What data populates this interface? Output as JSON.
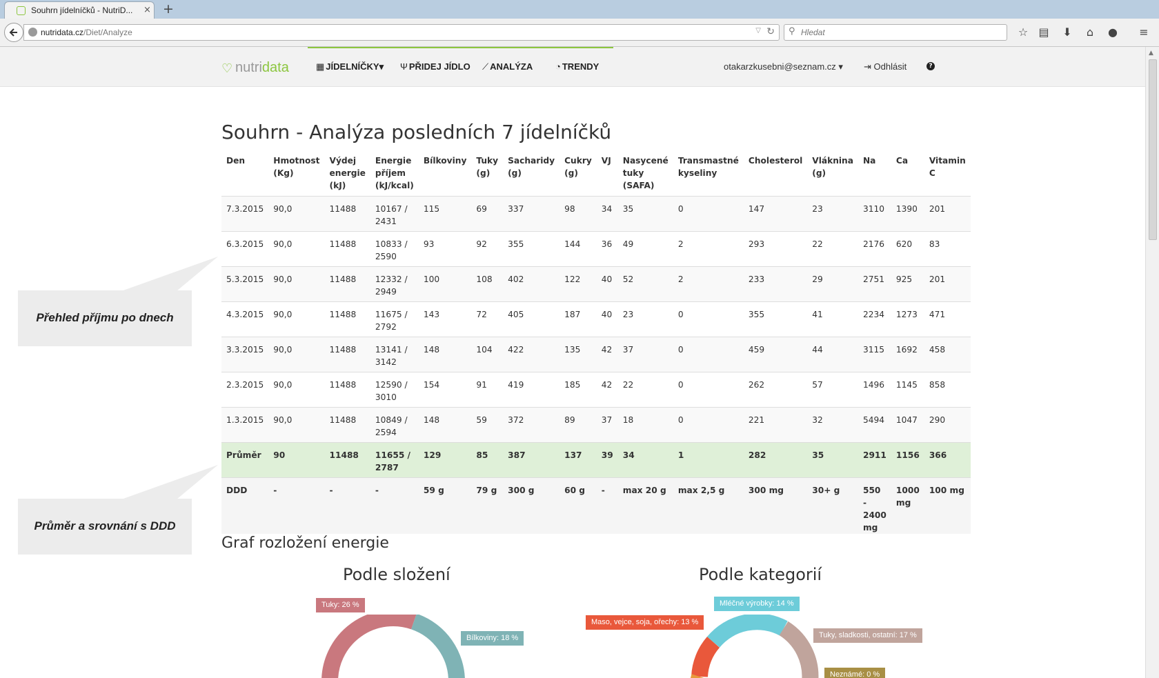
{
  "browser": {
    "tab_title": "Souhrn jídelníčků - NutriD...",
    "tab_close": "×",
    "new_tab": "+",
    "url_host": "nutridata.cz",
    "url_path": "/Diet/Analyze",
    "search_placeholder": "Hledat"
  },
  "site": {
    "logo_text_a": "nutri",
    "logo_text_b": "data",
    "nav": [
      {
        "label": "JÍDELNÍČKY",
        "icon": "calendar-icon",
        "has_dropdown": true
      },
      {
        "label": "PŘIDEJ JÍDLO",
        "icon": "cutlery-icon"
      },
      {
        "label": "ANALÝZA",
        "icon": "line-chart-icon"
      },
      {
        "label": "TRENDY",
        "icon": "dashboard-icon"
      }
    ],
    "user_email": "otakarzkusebni@seznam.cz",
    "logout_label": "Odhlásit",
    "help_label": "?"
  },
  "page_title": "Souhrn - Analýza posledních 7 jídelníčků",
  "table": {
    "headers": [
      "Den",
      "Hmotnost (Kg)",
      "Výdej energie (kJ)",
      "Energie příjem (kJ/kcal)",
      "Bílkoviny",
      "Tuky (g)",
      "Sacharidy (g)",
      "Cukry (g)",
      "VJ",
      "Nasycené tuky (SAFA)",
      "Transmastné kyseliny",
      "Cholesterol",
      "Vláknina (g)",
      "Na",
      "Ca",
      "Vitamin C"
    ],
    "rows": [
      [
        "7.3.2015",
        "90,0",
        "11488",
        "10167 / 2431",
        "115",
        "69",
        "337",
        "98",
        "34",
        "35",
        "0",
        "147",
        "23",
        "3110",
        "1390",
        "201"
      ],
      [
        "6.3.2015",
        "90,0",
        "11488",
        "10833 / 2590",
        "93",
        "92",
        "355",
        "144",
        "36",
        "49",
        "2",
        "293",
        "22",
        "2176",
        "620",
        "83"
      ],
      [
        "5.3.2015",
        "90,0",
        "11488",
        "12332 / 2949",
        "100",
        "108",
        "402",
        "122",
        "40",
        "52",
        "2",
        "233",
        "29",
        "2751",
        "925",
        "201"
      ],
      [
        "4.3.2015",
        "90,0",
        "11488",
        "11675 / 2792",
        "143",
        "72",
        "405",
        "187",
        "40",
        "23",
        "0",
        "355",
        "41",
        "2234",
        "1273",
        "471"
      ],
      [
        "3.3.2015",
        "90,0",
        "11488",
        "13141 / 3142",
        "148",
        "104",
        "422",
        "135",
        "42",
        "37",
        "0",
        "459",
        "44",
        "3115",
        "1692",
        "458"
      ],
      [
        "2.3.2015",
        "90,0",
        "11488",
        "12590 / 3010",
        "154",
        "91",
        "419",
        "185",
        "42",
        "22",
        "0",
        "262",
        "57",
        "1496",
        "1145",
        "858"
      ],
      [
        "1.3.2015",
        "90,0",
        "11488",
        "10849 / 2594",
        "148",
        "59",
        "372",
        "89",
        "37",
        "18",
        "0",
        "221",
        "32",
        "5494",
        "1047",
        "290"
      ]
    ],
    "average": [
      "Průměr",
      "90",
      "11488",
      "11655 / 2787",
      "129",
      "85",
      "387",
      "137",
      "39",
      "34",
      "1",
      "282",
      "35",
      "2911",
      "1156",
      "366"
    ],
    "ddd": [
      "DDD",
      "-",
      "-",
      "-",
      "59 g",
      "79 g",
      "300 g",
      "60 g",
      "-",
      "max 20 g",
      "max 2,5 g",
      "300 mg",
      "30+ g",
      "550 - 2400 mg",
      "1000 mg",
      "100 mg"
    ]
  },
  "callouts": {
    "daily": "Přehled příjmu po dnech",
    "average": "Průměr a srovnání s DDD"
  },
  "section_title": "Graf rozložení energie",
  "charts": {
    "composition": {
      "title": "Podle složení",
      "labels": {
        "fat": "Tuky: 26 %",
        "protein": "Bílkoviny: 18 %"
      }
    },
    "categories": {
      "title": "Podle kategorií",
      "labels": {
        "dairy": "Mléčné výrobky: 14 %",
        "meat": "Maso, vejce, soja, ořechy: 13 %",
        "fats_sweets": "Tuky, sladkosti, ostatní: 17 %",
        "unknown": "Neznámé: 0 %"
      }
    }
  },
  "chart_data": [
    {
      "type": "pie",
      "title": "Podle složení",
      "labels": [
        "Tuky",
        "Bílkoviny"
      ],
      "values": [
        26,
        18
      ],
      "colors": [
        "#c9787e",
        "#7fb3b5"
      ]
    },
    {
      "type": "pie",
      "title": "Podle kategorií",
      "labels": [
        "Mléčné výrobky",
        "Maso, vejce, soja, ořechy",
        "Tuky, sladkosti, ostatní",
        "Neznámé"
      ],
      "values": [
        14,
        13,
        17,
        0
      ],
      "colors": [
        "#6dccd9",
        "#e9583b",
        "#c0a49c",
        "#a88f45"
      ]
    }
  ],
  "colors": {
    "brand_green": "#8cc63f",
    "avg_row": "#dff0d8",
    "callout_bg": "#ececec"
  }
}
